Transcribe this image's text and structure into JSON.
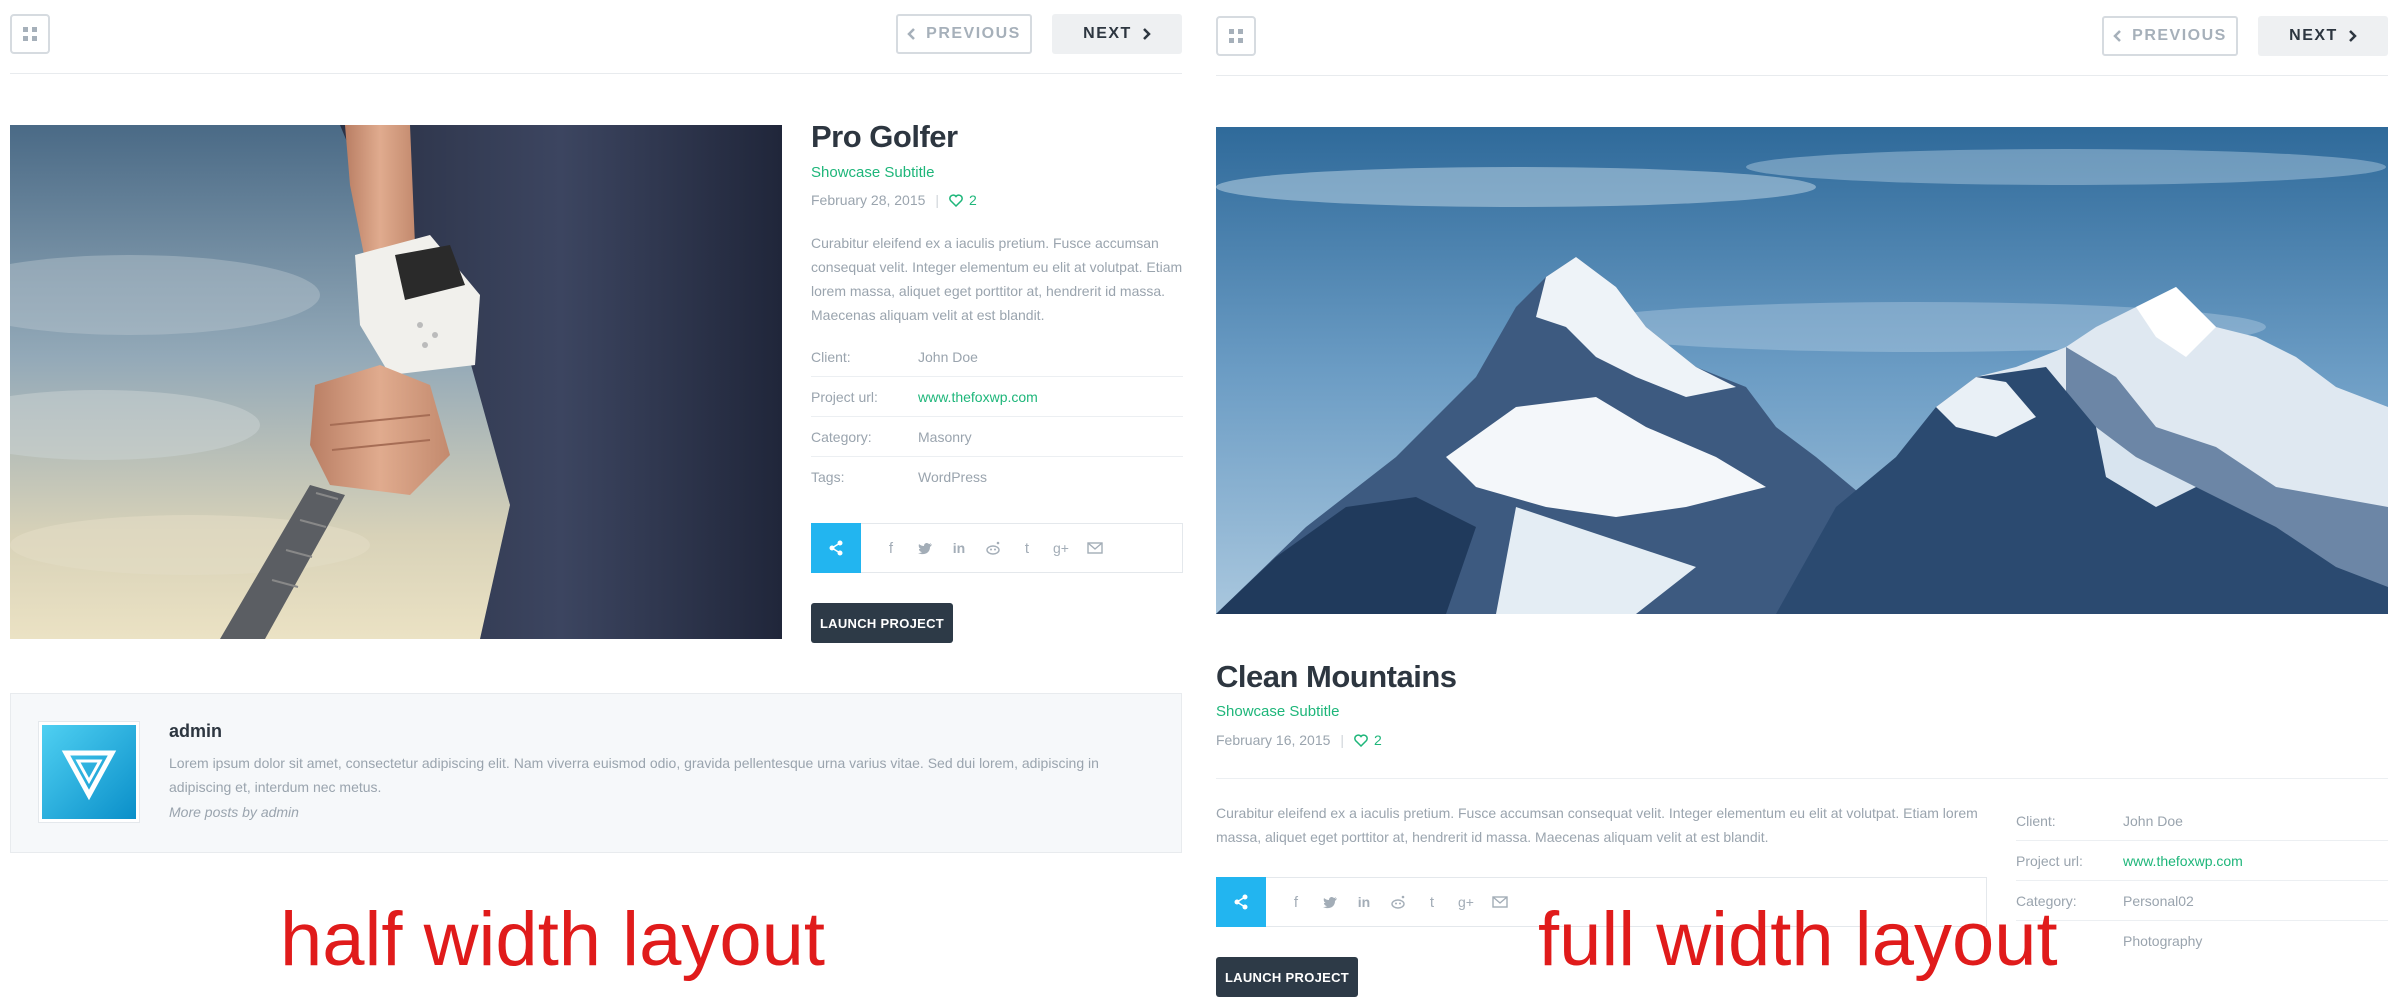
{
  "nav": {
    "previous_label": "PREVIOUS",
    "next_label": "NEXT"
  },
  "half": {
    "title": "Pro Golfer",
    "subtitle": "Showcase Subtitle",
    "date": "February 28, 2015",
    "likes": "2",
    "description": "Curabitur eleifend ex a iaculis pretium. Fusce accumsan consequat velit. Integer elementum eu elit at volutpat. Etiam lorem massa, aliquet eget porttitor at, hendrerit id massa. Maecenas aliquam velit at est blandit.",
    "details": [
      {
        "label": "Client:",
        "value": "John Doe"
      },
      {
        "label": "Project url:",
        "value": "www.thefoxwp.com"
      },
      {
        "label": "Category:",
        "value": "Masonry"
      },
      {
        "label": "Tags:",
        "value": "WordPress"
      }
    ],
    "launch_label": "LAUNCH PROJECT",
    "caption": "half width layout"
  },
  "author": {
    "name": "admin",
    "bio": "Lorem ipsum dolor sit amet, consectetur adipiscing elit. Nam viverra euismod odio, gravida pellentesque urna varius vitae. Sed dui lorem, adipiscing in adipiscing et, interdum nec metus.",
    "more": "More posts by admin"
  },
  "full": {
    "title": "Clean Mountains",
    "subtitle": "Showcase Subtitle",
    "date": "February 16, 2015",
    "likes": "2",
    "description": "Curabitur eleifend ex a iaculis pretium. Fusce accumsan consequat velit. Integer elementum eu elit at volutpat. Etiam lorem massa, aliquet eget porttitor at, hendrerit id massa. Maecenas aliquam velit at est blandit.",
    "details": [
      {
        "label": "Client:",
        "value": "John Doe"
      },
      {
        "label": "Project url:",
        "value": "www.thefoxwp.com"
      },
      {
        "label": "Category:",
        "value": "Personal02"
      },
      {
        "label": "",
        "value": "Photography"
      }
    ],
    "launch_label": "LAUNCH PROJECT",
    "caption": "full width layout"
  },
  "share_icons": [
    "facebook-icon",
    "twitter-icon",
    "linkedin-icon",
    "reddit-icon",
    "tumblr-icon",
    "google-plus-icon",
    "email-icon"
  ],
  "colors": {
    "accent_green": "#1eb67a",
    "share_blue": "#22b5f0",
    "dark_button": "#2d3a47",
    "caption_red": "#e01b1b"
  }
}
